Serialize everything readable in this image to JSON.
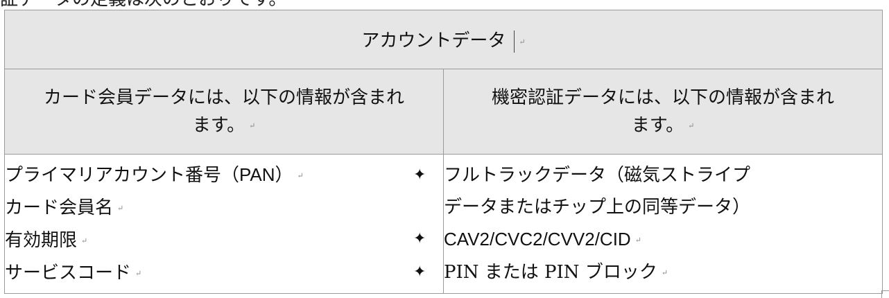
{
  "top_text": "証データの定義は次のとおりです。",
  "table": {
    "title": "アカウントデータ",
    "left_header_line1": "カード会員データには、以下の情報が含まれ",
    "left_header_line2": "ます。",
    "right_header_line1": "機密認証データには、以下の情報が含まれ",
    "right_header_line2": "ます。",
    "left_items": [
      {
        "text": "プライマリアカウント番号",
        "suffix": "（PAN）"
      },
      {
        "text": "カード会員名",
        "suffix": ""
      },
      {
        "text": "有効期限",
        "suffix": ""
      },
      {
        "text": "サービスコード",
        "suffix": ""
      }
    ],
    "right_items": [
      {
        "line1": "フルトラックデータ（磁気ストライプ",
        "line2": "データまたはチップ上の同等データ）"
      },
      {
        "line1": "CAV2/CVC2/CVV2/CID",
        "line2": ""
      },
      {
        "line1": "PIN または PIN ブロック",
        "line2": ""
      }
    ],
    "bullet": "✦",
    "para_mark": "↵"
  }
}
